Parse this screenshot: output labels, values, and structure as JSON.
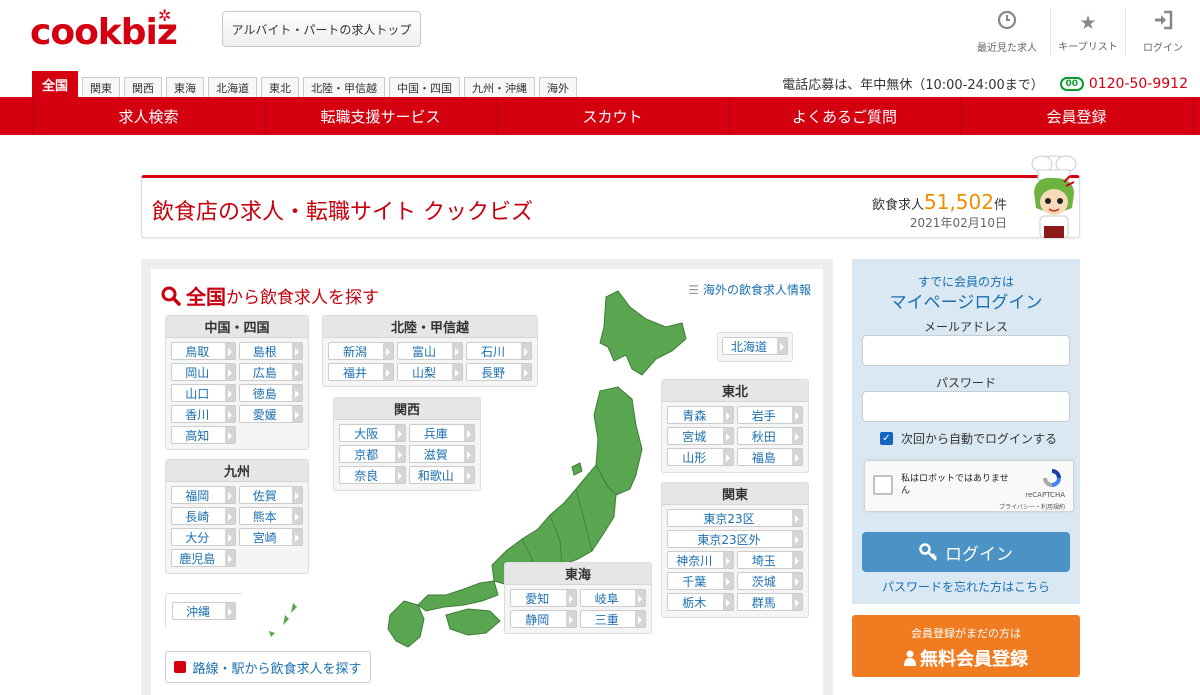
{
  "header": {
    "logo": "cookbiz",
    "top_button": "アルバイト・パートの求人トップ",
    "icons": [
      {
        "label": "最近見た求人",
        "icon": "clock-icon"
      },
      {
        "label": "キープリスト",
        "icon": "star-icon"
      },
      {
        "label": "ログイン",
        "icon": "login-icon"
      }
    ]
  },
  "region_tabs": [
    "全国",
    "関東",
    "関西",
    "東海",
    "北海道",
    "東北",
    "北陸・甲信越",
    "中国・四国",
    "九州・沖縄",
    "海外"
  ],
  "phone": {
    "text": "電話応募は、年中無休（10:00-24:00まで）",
    "badge": "00",
    "number": "0120-50-9912"
  },
  "nav": [
    "求人検索",
    "転職支援サービス",
    "スカウト",
    "よくあるご質問",
    "会員登録"
  ],
  "title_card": {
    "title": "飲食店の求人・転職サイト クックビズ",
    "count_prefix": "飲食求人",
    "count": "51,502",
    "count_suffix": "件",
    "date": "2021年02月10日"
  },
  "search": {
    "title_big": "全国",
    "title_rest": "から飲食求人を探す",
    "overseas_link": "海外の飲食求人情報",
    "route_button": "路線・駅から飲食求人を探す",
    "regions": {
      "chugoku": {
        "name": "中国・四国",
        "prefs": [
          "鳥取",
          "島根",
          "岡山",
          "広島",
          "山口",
          "徳島",
          "香川",
          "愛媛",
          "高知"
        ]
      },
      "kyushu": {
        "name": "九州",
        "prefs": [
          "福岡",
          "佐賀",
          "長崎",
          "熊本",
          "大分",
          "宮崎",
          "鹿児島"
        ]
      },
      "okinawa": {
        "prefs": [
          "沖縄"
        ]
      },
      "hokuriku": {
        "name": "北陸・甲信越",
        "prefs": [
          "新潟",
          "富山",
          "石川",
          "福井",
          "山梨",
          "長野"
        ]
      },
      "kansai": {
        "name": "関西",
        "prefs": [
          "大阪",
          "兵庫",
          "京都",
          "滋賀",
          "奈良",
          "和歌山"
        ]
      },
      "hokkaido": {
        "prefs": [
          "北海道"
        ]
      },
      "tohoku": {
        "name": "東北",
        "prefs": [
          "青森",
          "岩手",
          "宮城",
          "秋田",
          "山形",
          "福島"
        ]
      },
      "kanto": {
        "name": "関東",
        "prefs": [
          "東京23区",
          "東京23区外",
          "神奈川",
          "埼玉",
          "千葉",
          "茨城",
          "栃木",
          "群馬"
        ]
      },
      "tokai": {
        "name": "東海",
        "prefs": [
          "愛知",
          "岐阜",
          "静岡",
          "三重"
        ]
      }
    }
  },
  "login": {
    "subtitle": "すでに会員の方は",
    "title": "マイページログイン",
    "email_label": "メールアドレス",
    "password_label": "パスワード",
    "remember": "次回から自動でログインする",
    "recaptcha_text": "私はロボットではありません",
    "recaptcha_brand": "reCAPTCHA",
    "recaptcha_links": "プライバシー・利用規約",
    "login_button": "ログイン",
    "forgot": "パスワードを忘れた方はこちら"
  },
  "register": {
    "small": "会員登録がまだの方は",
    "big": "無料会員登録"
  },
  "colors": {
    "brand_red": "#d4000f",
    "map_green": "#5aa550",
    "login_blue": "#4c93c5",
    "register_orange": "#ef7c20"
  }
}
